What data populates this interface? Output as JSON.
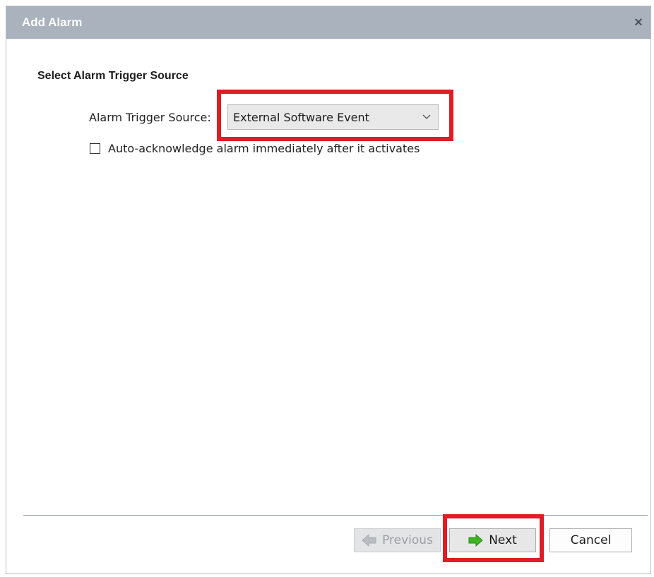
{
  "window": {
    "title": "Add Alarm",
    "close_glyph": "×"
  },
  "section": {
    "heading": "Select Alarm Trigger Source"
  },
  "trigger_source": {
    "label": "Alarm Trigger Source:",
    "selected_value": "External Software Event"
  },
  "auto_ack": {
    "label": "Auto-acknowledge alarm immediately after it activates",
    "checked": false
  },
  "buttons": {
    "previous": "Previous",
    "next": "Next",
    "cancel": "Cancel"
  },
  "colors": {
    "titlebar": "#aab2bd",
    "highlight": "#e01c24",
    "next_arrow": "#3cb521",
    "previous_arrow_disabled": "#b9bcc1"
  },
  "icons": {
    "close": "close-icon",
    "dropdown": "chevron-down-icon",
    "previous": "arrow-left-icon",
    "next": "arrow-right-icon"
  }
}
